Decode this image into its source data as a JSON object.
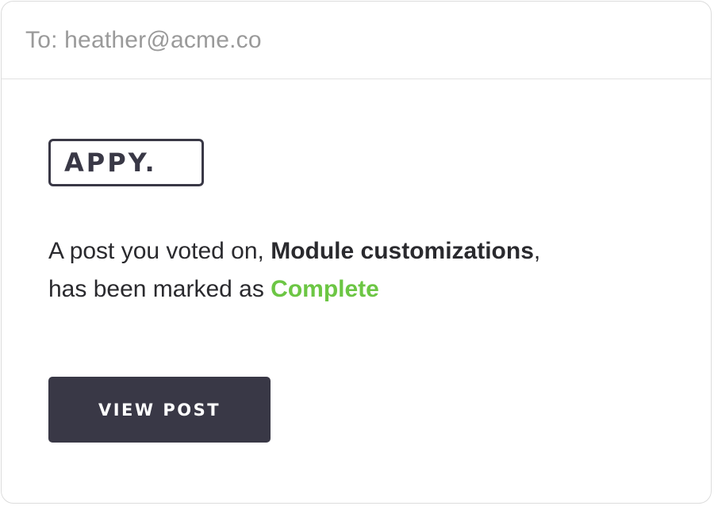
{
  "email": {
    "recipient_label": "To:",
    "recipient_address": "heather@acme.co"
  },
  "logo": {
    "text": "APPY."
  },
  "message": {
    "part1": "A post you voted on, ",
    "post_title": "Module customizations",
    "part2": ",",
    "part3": "has been marked as ",
    "status": "Complete"
  },
  "button": {
    "label": "VIEW POST"
  },
  "colors": {
    "status_complete": "#6cc644",
    "button_bg": "#393846",
    "logo_border": "#393846"
  }
}
